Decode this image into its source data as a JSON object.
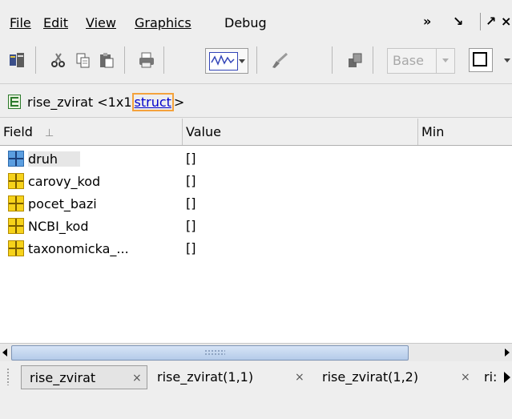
{
  "menubar": {
    "items": [
      "File",
      "Edit",
      "View",
      "Graphics",
      "Debug"
    ],
    "mnemonics": [
      "F",
      "E",
      "V",
      "G",
      "b"
    ],
    "window_controls": [
      "»",
      "↘",
      "↗",
      "×"
    ]
  },
  "toolbar": {
    "base_select": {
      "label": "Base",
      "enabled": false
    }
  },
  "path": {
    "variable": "rise_zvirat",
    "size": "<1x1",
    "type": "struct",
    "close": ">"
  },
  "table": {
    "columns": [
      "Field",
      "Value",
      "Min"
    ],
    "sort_indicator": "⊥",
    "rows": [
      {
        "field": "druh",
        "value": "[]",
        "icon": "struct-field-blue-icon",
        "selected": true
      },
      {
        "field": "carovy_kod",
        "value": "[]",
        "icon": "struct-field-yellow-icon",
        "selected": false
      },
      {
        "field": "pocet_bazi",
        "value": "[]",
        "icon": "struct-field-yellow-icon",
        "selected": false
      },
      {
        "field": "NCBI_kod",
        "value": "[]",
        "icon": "struct-field-yellow-icon",
        "selected": false
      },
      {
        "field": "taxonomicka_...",
        "value": "[]",
        "icon": "struct-field-yellow-icon",
        "selected": false
      }
    ]
  },
  "tabs": [
    {
      "label": "rise_zvirat",
      "active": true,
      "close": "×"
    },
    {
      "label": "rise_zvirat(1,1)",
      "active": false,
      "close": "×"
    },
    {
      "label": "rise_zvirat(1,2)",
      "active": false,
      "close": "×"
    },
    {
      "label": "ri:",
      "active": false
    }
  ],
  "colors": {
    "accent_link": "#0000cc",
    "selection_outline": "#f4a23c",
    "scroll_thumb": "#c6d8ef"
  }
}
